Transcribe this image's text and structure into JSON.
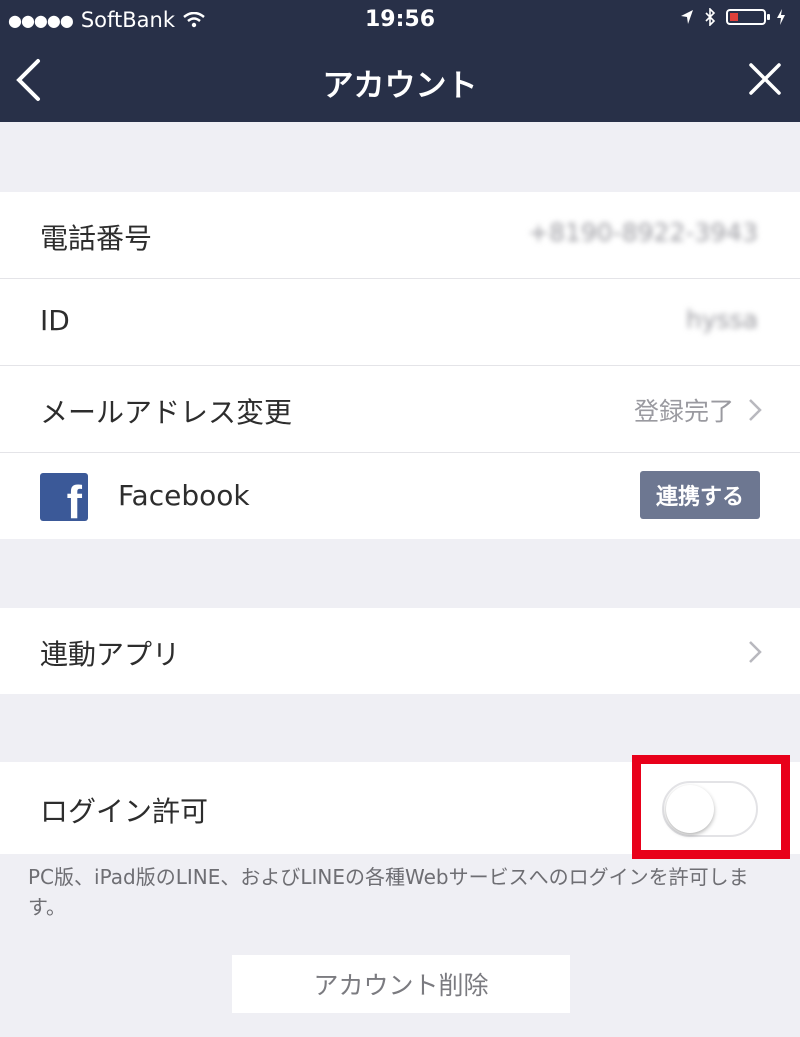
{
  "status_bar": {
    "carrier": "SoftBank",
    "time": "19:56",
    "icons": [
      "signal-dots-icon",
      "wifi-icon",
      "location-icon",
      "bluetooth-icon",
      "battery-icon",
      "charging-icon"
    ]
  },
  "nav": {
    "title": "アカウント",
    "back_icon": "chevron-left-icon",
    "close_icon": "close-icon"
  },
  "account_rows": {
    "phone_label": "電話番号",
    "phone_value": "+8190-8922-3943",
    "id_label": "ID",
    "id_value": "hyssa",
    "email_label": "メールアドレス変更",
    "email_status": "登録完了",
    "facebook_label": "Facebook",
    "facebook_button": "連携する"
  },
  "apps_row": {
    "label": "連動アプリ"
  },
  "login_row": {
    "label": "ログイン許可",
    "toggle_on": false
  },
  "login_note": "PC版、iPad版のLINE、およびLINEの各種Webサービスへのログインを許可します。",
  "delete_button": "アカウント削除",
  "colors": {
    "nav_bg": "#283048",
    "page_bg": "#efeff4",
    "facebook": "#3b5998",
    "link_button": "#6d7791",
    "highlight": "#e8001a"
  }
}
